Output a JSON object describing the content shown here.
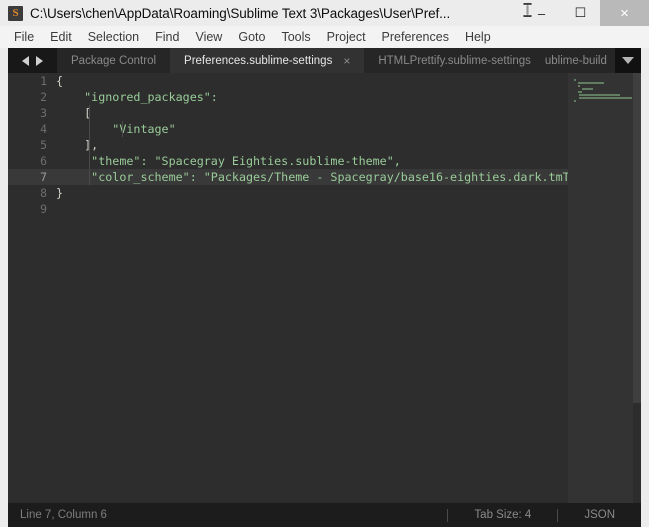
{
  "window": {
    "title": "C:\\Users\\chen\\AppData\\Roaming\\Sublime Text 3\\Packages\\User\\Pref...",
    "app_icon_letter": "S",
    "controls": {
      "minimize": "–",
      "maximize": "☐",
      "close": "×"
    }
  },
  "menubar": {
    "items": [
      {
        "label": "File"
      },
      {
        "label": "Edit"
      },
      {
        "label": "Selection"
      },
      {
        "label": "Find"
      },
      {
        "label": "View"
      },
      {
        "label": "Goto"
      },
      {
        "label": "Tools"
      },
      {
        "label": "Project"
      },
      {
        "label": "Preferences"
      },
      {
        "label": "Help"
      }
    ]
  },
  "tabbar": {
    "nav_prev": "◀",
    "nav_next": "▶",
    "dropdown": "▼",
    "close_glyph": "×",
    "tabs": [
      {
        "label": "Package Control",
        "active": false
      },
      {
        "label": "Preferences.sublime-settings",
        "active": true
      },
      {
        "label": "HTMLPrettify.sublime-settings",
        "active": false
      },
      {
        "label": "ublime-build",
        "active": false
      }
    ]
  },
  "editor": {
    "language": "JSON",
    "current_line": 7,
    "line_numbers": [
      "1",
      "2",
      "3",
      "4",
      "5",
      "6",
      "7",
      "8",
      "9"
    ],
    "lines": [
      {
        "n": "1",
        "text": "{"
      },
      {
        "n": "2",
        "text": "    \"ignored_packages\":"
      },
      {
        "n": "3",
        "text": "    ["
      },
      {
        "n": "4",
        "text": "        \"Vintage\""
      },
      {
        "n": "5",
        "text": "    ],"
      },
      {
        "n": "6",
        "text": "     \"theme\": \"Spacegray Eighties.sublime-theme\","
      },
      {
        "n": "7",
        "text": "     \"color_scheme\": \"Packages/Theme - Spacegray/base16-eighties.dark.tmT"
      },
      {
        "n": "8",
        "text": "}"
      },
      {
        "n": "9",
        "text": ""
      }
    ]
  },
  "statusbar": {
    "cursor": "Line 7, Column 6",
    "tab_size": "Tab Size: 4",
    "syntax": "JSON"
  },
  "colors": {
    "editor_bg": "#2d2d2d",
    "string_green": "#99cc99",
    "punctuation": "#cfcbc2",
    "current_line_bg": "#393939",
    "tabbar_bg": "#1d1d1d",
    "statusbar_bg": "#1c1c1c",
    "icon_orange": "#e08a2e"
  }
}
